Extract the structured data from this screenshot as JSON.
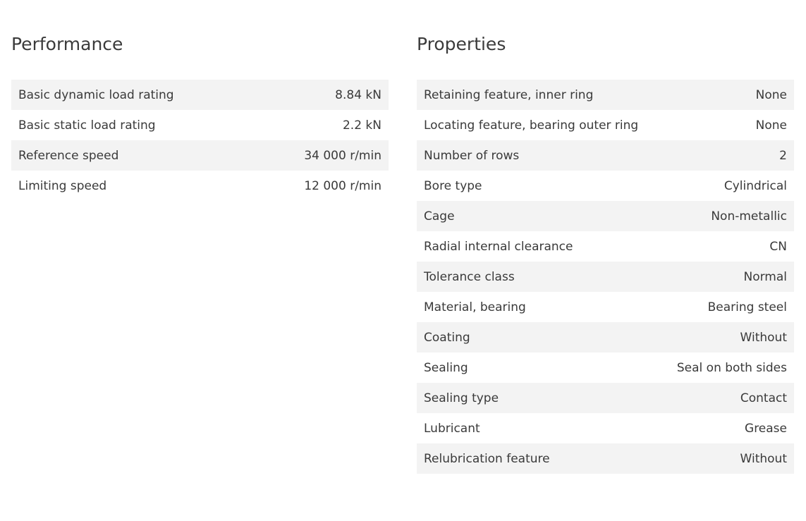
{
  "performance": {
    "title": "Performance",
    "rows": [
      {
        "label": "Basic dynamic load rating",
        "value": "8.84 kN"
      },
      {
        "label": "Basic static load rating",
        "value": "2.2 kN"
      },
      {
        "label": "Reference speed",
        "value": "34 000 r/min"
      },
      {
        "label": "Limiting speed",
        "value": "12 000 r/min"
      }
    ]
  },
  "properties": {
    "title": "Properties",
    "rows": [
      {
        "label": "Retaining feature, inner ring",
        "value": "None"
      },
      {
        "label": "Locating feature, bearing outer ring",
        "value": "None"
      },
      {
        "label": "Number of rows",
        "value": "2"
      },
      {
        "label": "Bore type",
        "value": "Cylindrical"
      },
      {
        "label": "Cage",
        "value": "Non-metallic"
      },
      {
        "label": "Radial internal clearance",
        "value": "CN"
      },
      {
        "label": "Tolerance class",
        "value": "Normal"
      },
      {
        "label": "Material, bearing",
        "value": "Bearing steel"
      },
      {
        "label": "Coating",
        "value": "Without"
      },
      {
        "label": "Sealing",
        "value": "Seal on both sides"
      },
      {
        "label": "Sealing type",
        "value": "Contact"
      },
      {
        "label": "Lubricant",
        "value": "Grease"
      },
      {
        "label": "Relubrication feature",
        "value": "Without"
      }
    ]
  }
}
